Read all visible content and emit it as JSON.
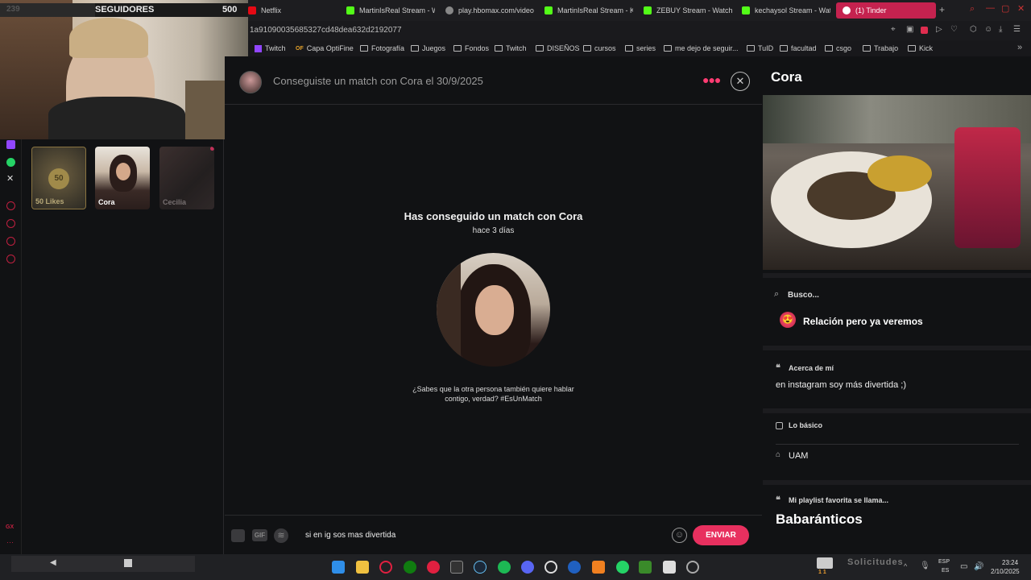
{
  "stream": {
    "count_left": "239",
    "label": "SEGUIDORES",
    "count_right": "500"
  },
  "tabs": [
    {
      "label": "Netflix",
      "color": "#e50914"
    },
    {
      "label": "MartinIsReal Stream - W",
      "color": "#53fc18"
    },
    {
      "label": "play.hbomax.com/video",
      "color": "#888888"
    },
    {
      "label": "MartinIsReal Stream - K",
      "color": "#53fc18"
    },
    {
      "label": "ZEBUY Stream - Watch",
      "color": "#53fc18"
    },
    {
      "label": "kechaysol Stream - Wat",
      "color": "#53fc18"
    },
    {
      "label": "(1) Tinder",
      "color": "#fe3c72"
    }
  ],
  "url": "1a91090035685327cd48dea632d2192077",
  "bookmarks": [
    "Twitch",
    "Capa OptiFine",
    "Fotografía",
    "Juegos",
    "Fondos",
    "Twitch",
    "DISEÑOS",
    "cursos",
    "series",
    "me dejo de seguir...",
    "TuID",
    "facultad",
    "csgo",
    "Trabajo",
    "Kick"
  ],
  "left": {
    "likes_count": "50",
    "likes_label": "50 Likes",
    "matches": [
      "Cora",
      "Cecilia"
    ]
  },
  "chat": {
    "header": "Conseguiste un match con Cora el 30/9/2025",
    "match_title_prefix": "Has conseguido un match con ",
    "match_name": "Cora",
    "time_ago": "hace 3 días",
    "prompt_line1": "¿Sabes que la otra persona también quiere hablar",
    "prompt_line2": "contigo, verdad? #EsUnMatch",
    "input_value": "si en ig sos mas divertida",
    "gif_label": "GIF",
    "send_label": "ENVIAR"
  },
  "profile": {
    "name": "Cora",
    "looking_label": "Busco...",
    "looking_value": "Relación pero ya veremos",
    "about_label": "Acerca de mí",
    "about_value": "en instagram soy más divertida ;)",
    "basics_label": "Lo básico",
    "basics_value": "UAM",
    "playlist_label": "Mi playlist favorita se llama...",
    "playlist_value": "Babaránticos"
  },
  "taskbar": {
    "solicitudes": "Solicitudes",
    "lang1": "ESP",
    "lang2": "ES",
    "time": "23:24",
    "date": "2/10/2025",
    "mail_badge": "1 1"
  },
  "colors": {
    "accent": "#fe3c72",
    "send": "#e8305f"
  }
}
